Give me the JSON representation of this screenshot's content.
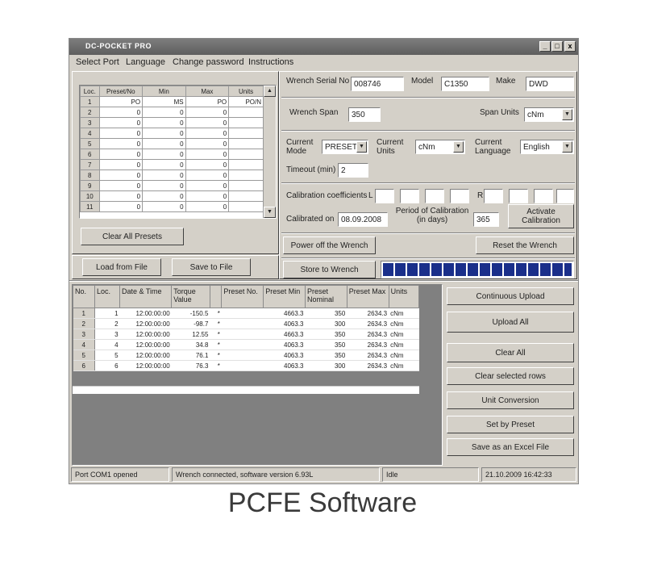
{
  "window": {
    "title": "DC-POCKET PRO",
    "controls": [
      "_",
      "□",
      "x"
    ]
  },
  "menu": [
    "Select Port",
    "Language",
    "Change password",
    "Instructions"
  ],
  "presets": {
    "headers": [
      "Loc.",
      "Preset/No",
      "Min",
      "Max",
      "Units"
    ],
    "rows": [
      {
        "n": "1",
        "a": "PO",
        "b": "MS",
        "c": "PO",
        "d": "PO/N"
      },
      {
        "n": "2",
        "a": "0",
        "b": "0",
        "c": "0",
        "d": ""
      },
      {
        "n": "3",
        "a": "0",
        "b": "0",
        "c": "0",
        "d": ""
      },
      {
        "n": "4",
        "a": "0",
        "b": "0",
        "c": "0",
        "d": ""
      },
      {
        "n": "5",
        "a": "0",
        "b": "0",
        "c": "0",
        "d": ""
      },
      {
        "n": "6",
        "a": "0",
        "b": "0",
        "c": "0",
        "d": ""
      },
      {
        "n": "7",
        "a": "0",
        "b": "0",
        "c": "0",
        "d": ""
      },
      {
        "n": "8",
        "a": "0",
        "b": "0",
        "c": "0",
        "d": ""
      },
      {
        "n": "9",
        "a": "0",
        "b": "0",
        "c": "0",
        "d": ""
      },
      {
        "n": "10",
        "a": "0",
        "b": "0",
        "c": "0",
        "d": ""
      },
      {
        "n": "11",
        "a": "0",
        "b": "0",
        "c": "0",
        "d": ""
      }
    ],
    "clear_all": "Clear All Presets",
    "load": "Load from File",
    "save": "Save to File"
  },
  "wrench": {
    "serial_label": "Wrench Serial No",
    "serial": "008746",
    "model_label": "Model",
    "model": "C1350",
    "make_label": "Make",
    "make": "DWD",
    "span_label": "Wrench Span",
    "span": "350",
    "span_units_label": "Span Units",
    "span_units": "cNm",
    "mode_label": "Current Mode",
    "mode": "PRESET",
    "units_label": "Current Units",
    "units": "cNm",
    "lang_label": "Current Language",
    "language": "English",
    "timeout_label": "Timeout (min)",
    "timeout": "2",
    "calib_coeff_label": "Calibration coefficients",
    "calib_l": "L",
    "calib_r": "R",
    "calibrated_on_label": "Calibrated on",
    "calibrated_on": "08.09.2008",
    "period_label": "Period of Calibration (in days)",
    "period": "365",
    "activate": "Activate Calibration",
    "power_off": "Power off the Wrench",
    "reset": "Reset the Wrench",
    "store": "Store to Wrench",
    "progress": 1.0
  },
  "history": {
    "headers": [
      "No.",
      "Loc.",
      "Date & Time",
      "Torque Value",
      "",
      "Preset No.",
      "Preset Min",
      "Preset Nominal",
      "Preset Max",
      "Units"
    ],
    "rows": [
      {
        "no": "1",
        "loc": "1",
        "dt": "12:00:00:00",
        "tv": "-150.5",
        "f": "*",
        "pn": "",
        "pmin": "4663.3",
        "pnom": "350",
        "pmax": "2634.3",
        "u": "cNm"
      },
      {
        "no": "2",
        "loc": "2",
        "dt": "12:00:00:00",
        "tv": "-98.7",
        "f": "*",
        "pn": "",
        "pmin": "4063.3",
        "pnom": "300",
        "pmax": "2634.3",
        "u": "cNm"
      },
      {
        "no": "3",
        "loc": "3",
        "dt": "12:00:00:00",
        "tv": "12.55",
        "f": "*",
        "pn": "",
        "pmin": "4663.3",
        "pnom": "350",
        "pmax": "2634.3",
        "u": "cNm"
      },
      {
        "no": "4",
        "loc": "4",
        "dt": "12:00:00:00",
        "tv": "34.8",
        "f": "*",
        "pn": "",
        "pmin": "4063.3",
        "pnom": "350",
        "pmax": "2634.3",
        "u": "cNm"
      },
      {
        "no": "5",
        "loc": "5",
        "dt": "12:00:00:00",
        "tv": "76.1",
        "f": "*",
        "pn": "",
        "pmin": "4063.3",
        "pnom": "350",
        "pmax": "2634.3",
        "u": "cNm"
      },
      {
        "no": "6",
        "loc": "6",
        "dt": "12:00:00:00",
        "tv": "76.3",
        "f": "*",
        "pn": "",
        "pmin": "4063.3",
        "pnom": "300",
        "pmax": "2634.3",
        "u": "cNm"
      }
    ]
  },
  "actions": [
    "Continuous Upload",
    "Upload All",
    "Clear All",
    "Clear selected rows",
    "Unit Conversion",
    "Set by Preset",
    "Save as an Excel File"
  ],
  "status": {
    "port": "Port COM1 opened",
    "wrench": "Wrench connected, software version 6.93L",
    "state": "Idle",
    "datetime": "21.10.2009 16:42:33"
  },
  "caption": "PCFE Software"
}
